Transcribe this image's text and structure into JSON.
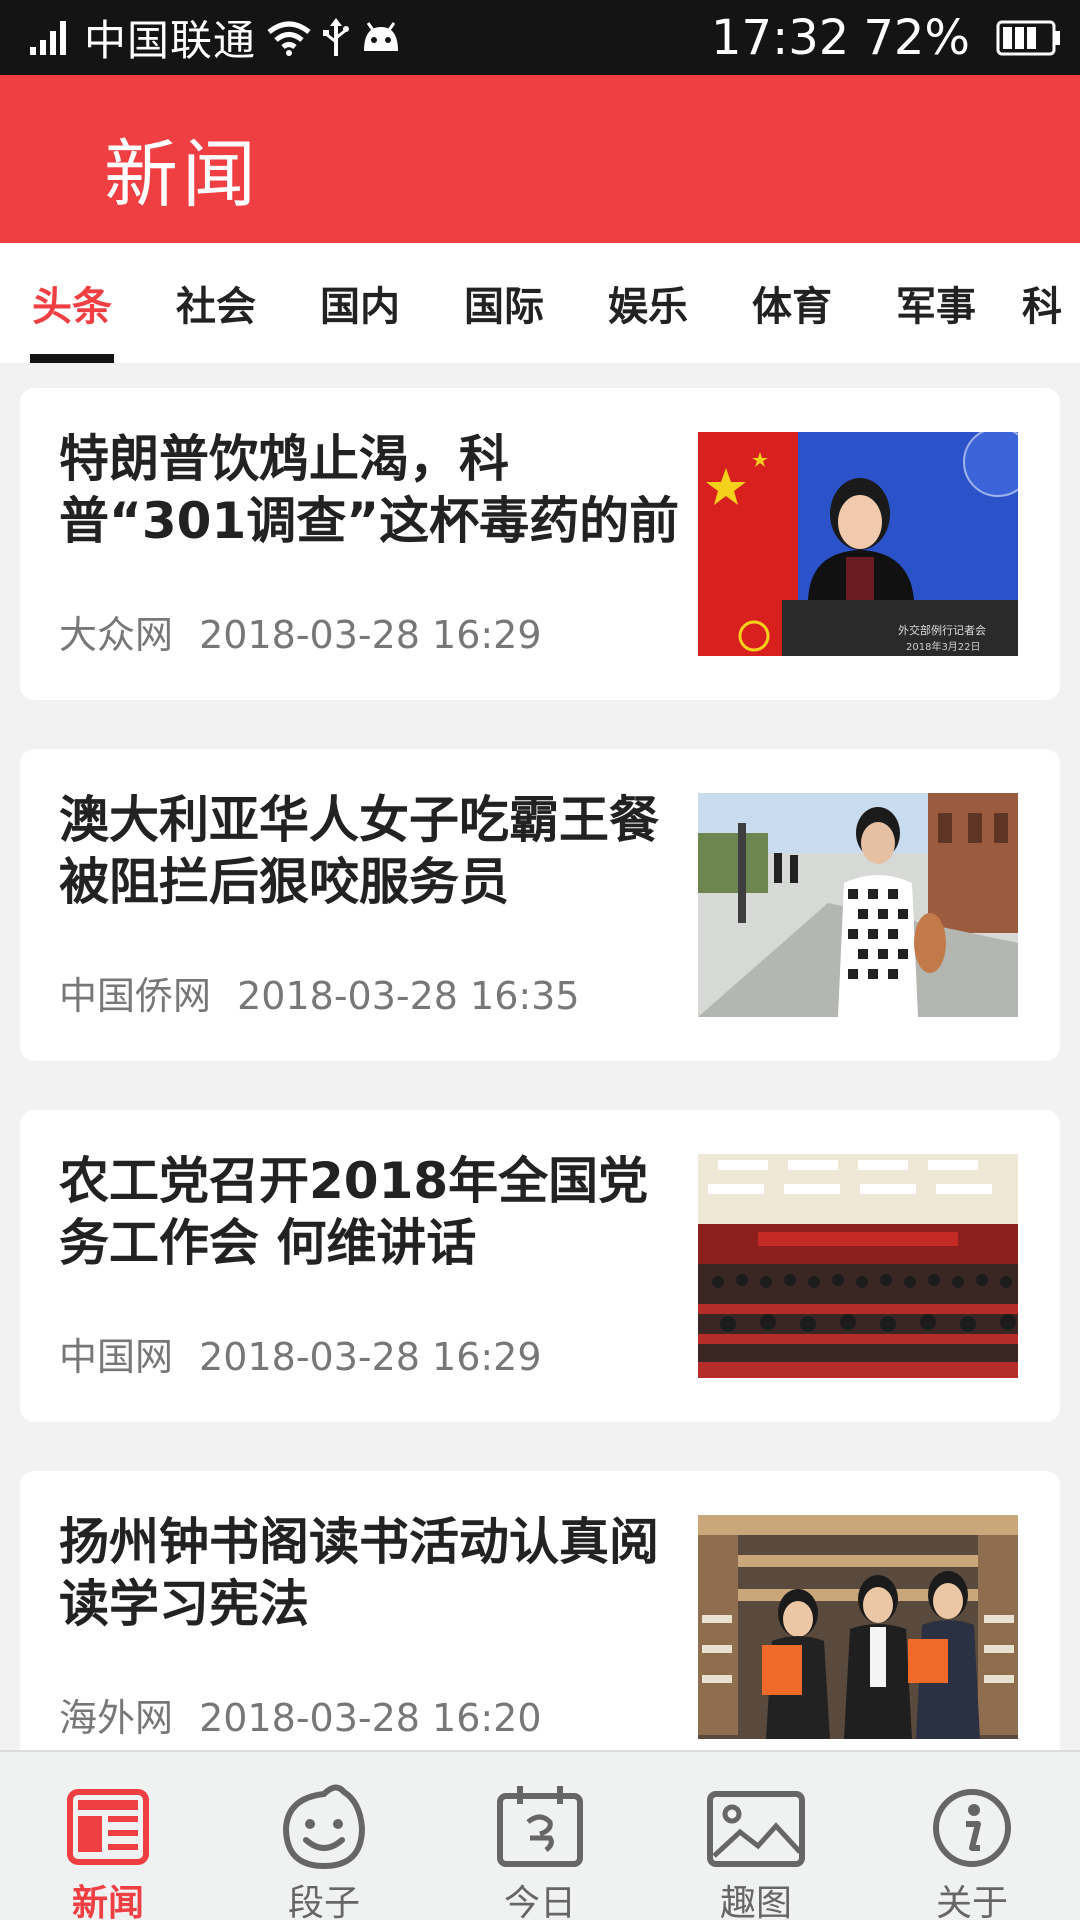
{
  "status_bar": {
    "carrier": "中国联通",
    "time": "17:32",
    "battery": "72%"
  },
  "header": {
    "title": "新闻"
  },
  "tabs": [
    {
      "label": "头条",
      "active": true
    },
    {
      "label": "社会",
      "active": false
    },
    {
      "label": "国内",
      "active": false
    },
    {
      "label": "国际",
      "active": false
    },
    {
      "label": "娱乐",
      "active": false
    },
    {
      "label": "体育",
      "active": false
    },
    {
      "label": "军事",
      "active": false
    },
    {
      "label": "科",
      "active": false
    }
  ],
  "news": [
    {
      "title": "特朗普饮鸩止渴，科普“301调查”这杯毒药的前",
      "source": "大众网",
      "time": "2018-03-28 16:29",
      "image_text": "外交部例行记者会 2018年3月22日"
    },
    {
      "title": "澳大利亚华人女子吃霸王餐 被阻拦后狠咬服务员",
      "source": "中国侨网",
      "time": "2018-03-28 16:35"
    },
    {
      "title": "农工党召开2018年全国党务工作会 何维讲话",
      "source": "中国网",
      "time": "2018-03-28 16:29"
    },
    {
      "title": "扬州钟书阁读书活动认真阅读学习宪法",
      "source": "海外网",
      "time": "2018-03-28 16:20"
    }
  ],
  "bottom_nav": [
    {
      "label": "新闻",
      "icon": "news-icon",
      "active": true
    },
    {
      "label": "段子",
      "icon": "smiley-icon",
      "active": false
    },
    {
      "label": "今日",
      "icon": "calendar-icon",
      "active": false
    },
    {
      "label": "趣图",
      "icon": "image-icon",
      "active": false
    },
    {
      "label": "关于",
      "icon": "info-icon",
      "active": false
    }
  ],
  "colors": {
    "accent": "#f03f43",
    "status_bar": "#141414",
    "background": "#f2f2f2"
  }
}
